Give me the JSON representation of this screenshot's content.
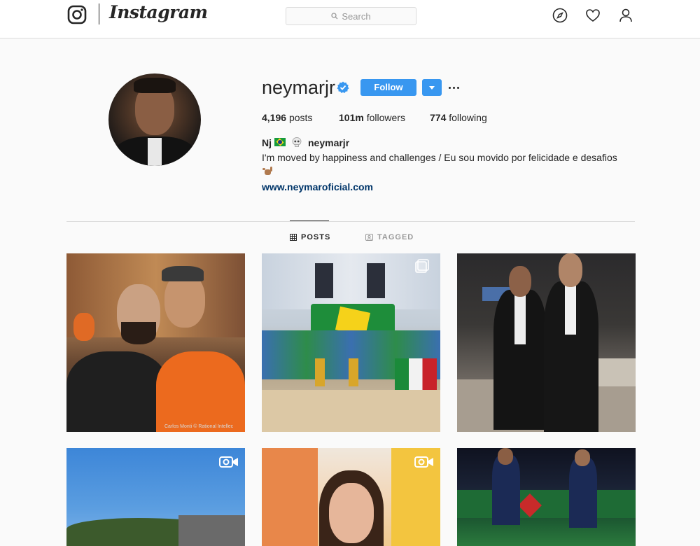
{
  "nav": {
    "brand": "Instagram",
    "search_placeholder": "Search",
    "icons": [
      "compass-icon",
      "heart-icon",
      "person-icon"
    ]
  },
  "profile": {
    "username": "neymarjr",
    "verified": true,
    "follow_label": "Follow",
    "stats": {
      "posts_count": "4,196",
      "posts_label": "posts",
      "followers_count": "101m",
      "followers_label": "followers",
      "following_count": "774",
      "following_label": "following"
    },
    "bio": {
      "name": "Nj",
      "handle": "neymarjr",
      "text": "I'm moved by happiness and challenges / Eu sou movido por felicidade e desafios",
      "link": "www.neymaroficial.com"
    }
  },
  "tabs": [
    {
      "label": "POSTS",
      "active": true
    },
    {
      "label": "TAGGED",
      "active": false
    }
  ],
  "posts": [
    {
      "type": "image",
      "overlay_text": "Carlos Monti © Rational Intellec"
    },
    {
      "type": "carousel"
    },
    {
      "type": "image"
    },
    {
      "type": "video"
    },
    {
      "type": "video"
    },
    {
      "type": "image"
    }
  ],
  "colors": {
    "accent": "#3897f0",
    "link": "#003569",
    "text": "#262626",
    "muted": "#999999",
    "background": "#fafafa"
  }
}
